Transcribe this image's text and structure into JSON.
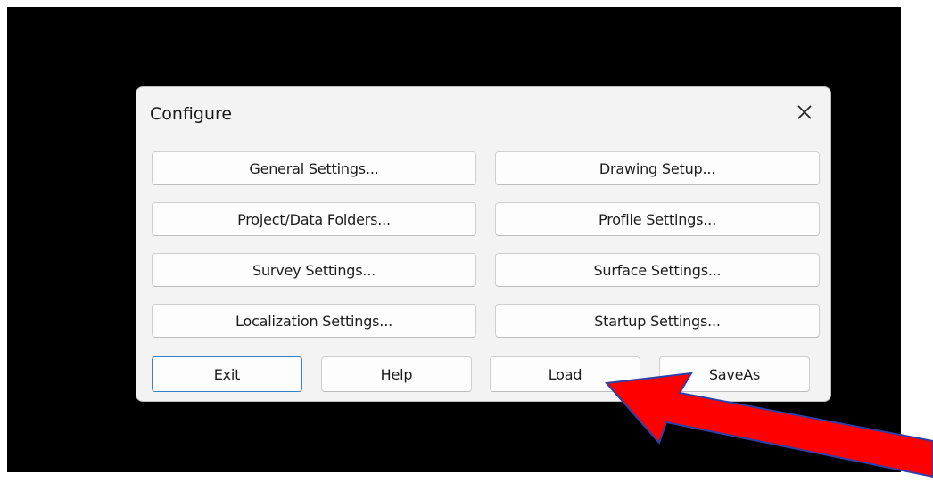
{
  "dialog": {
    "title": "Configure",
    "close_icon": "close-icon"
  },
  "settings_buttons": [
    "General Settings...",
    "Drawing Setup...",
    "Project/Data Folders...",
    "Profile Settings...",
    "Survey Settings...",
    "Surface Settings...",
    "Localization Settings...",
    "Startup Settings..."
  ],
  "footer_buttons": {
    "exit": "Exit",
    "help": "Help",
    "load": "Load",
    "saveas": "SaveAs"
  },
  "annotation": {
    "arrow_color": "#ff0000",
    "arrow_outline": "#2f3fa8",
    "icon": "red-arrow-icon"
  },
  "colors": {
    "default_button_border": "#3b7fc4"
  }
}
